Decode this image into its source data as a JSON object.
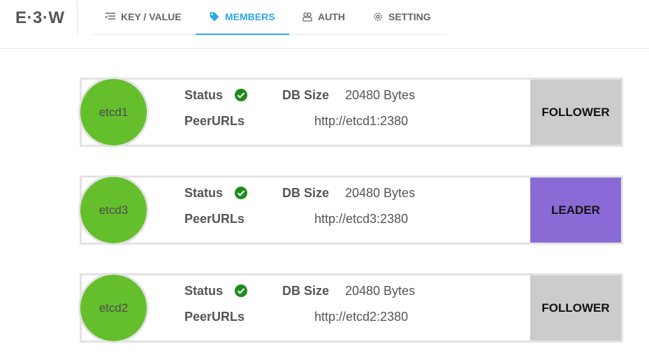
{
  "app": {
    "logo": "E·3·W"
  },
  "tabs": [
    {
      "label": "KEY / VALUE",
      "icon": "list-icon",
      "active": false
    },
    {
      "label": "MEMBERS",
      "icon": "tag-icon",
      "active": true
    },
    {
      "label": "AUTH",
      "icon": "users-icon",
      "active": false
    },
    {
      "label": "SETTING",
      "icon": "gear-icon",
      "active": false
    }
  ],
  "labels": {
    "status": "Status",
    "db_size": "DB Size",
    "peer_urls": "PeerURLs"
  },
  "members": [
    {
      "name": "etcd1",
      "status": "ok",
      "db_size": "20480 Bytes",
      "peer_url": "http://etcd1:2380",
      "role": "FOLLOWER"
    },
    {
      "name": "etcd3",
      "status": "ok",
      "db_size": "20480 Bytes",
      "peer_url": "http://etcd3:2380",
      "role": "LEADER"
    },
    {
      "name": "etcd2",
      "status": "ok",
      "db_size": "20480 Bytes",
      "peer_url": "http://etcd2:2380",
      "role": "FOLLOWER"
    }
  ],
  "colors": {
    "accent": "#2fa9e6",
    "member_green": "#65bf2d",
    "status_ok": "#1a8c1a",
    "leader": "#8a6bd6",
    "follower": "#cccccc"
  }
}
